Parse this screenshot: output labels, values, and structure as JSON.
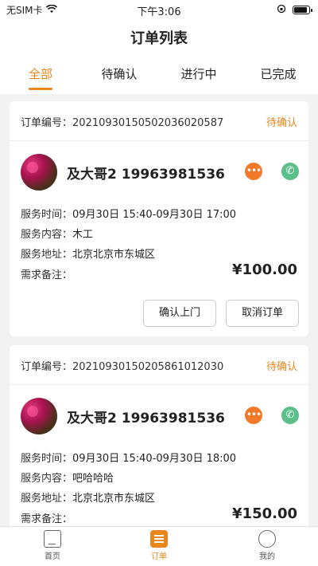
{
  "status_bar": {
    "carrier": "无SIM卡",
    "time": "下午3:06"
  },
  "nav": {
    "title": "订单列表"
  },
  "tabs": [
    {
      "label": "全部",
      "active": true
    },
    {
      "label": "待确认",
      "active": false
    },
    {
      "label": "进行中",
      "active": false
    },
    {
      "label": "已完成",
      "active": false
    }
  ],
  "orders": [
    {
      "number_label": "订单编号：",
      "number": "20210930150502036020587",
      "status": "待确认",
      "customer": "及大哥2  19963981536",
      "service_time_label": "服务时间：",
      "service_time": "09月30日 15:40-09月30日 17:00",
      "service_content_label": "服务内容：",
      "service_content": "木工",
      "service_address_label": "服务地址：",
      "service_address": "北京北京市东城区",
      "remark_label": "需求备注：",
      "price": "¥100.00",
      "confirm_label": "确认上门",
      "cancel_label": "取消订单"
    },
    {
      "number_label": "订单编号：",
      "number": "20210930150205861012030",
      "status": "待确认",
      "customer": "及大哥2  19963981536",
      "service_time_label": "服务时间：",
      "service_time": "09月30日 15:40-09月30日 18:00",
      "service_content_label": "服务内容：",
      "service_content": "吧哈哈哈",
      "service_address_label": "服务地址：",
      "service_address": "北京北京市东城区",
      "remark_label": "需求备注：",
      "price": "¥150.00"
    }
  ],
  "tab_bar": [
    {
      "label": "首页",
      "icon": "home-icon"
    },
    {
      "label": "订单",
      "icon": "order-icon"
    },
    {
      "label": "我的",
      "icon": "profile-icon"
    }
  ],
  "colors": {
    "accent": "#e8871e",
    "chat": "#f07a2a",
    "call": "#5bbf8a"
  }
}
